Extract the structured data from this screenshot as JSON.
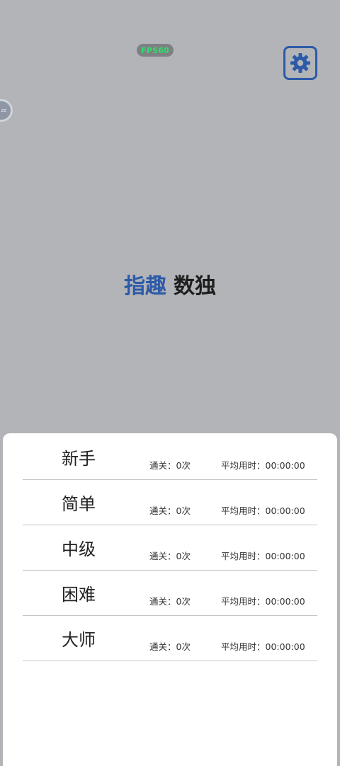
{
  "status": {
    "fps_label": "FPS60"
  },
  "toolbar": {
    "settings_icon": "gear-icon",
    "settings_color": "#2d5aa8"
  },
  "floating_badge": {
    "text": "zz"
  },
  "title": {
    "part1": "指趣",
    "part2": "数独",
    "part1_color": "#2d5aa8",
    "part2_color": "#1e1e1e"
  },
  "levels": [
    {
      "name": "新手",
      "clear_label": "通关：",
      "clear_value": "0次",
      "avg_label": "平均用时：",
      "avg_value": "00:00:00"
    },
    {
      "name": "简单",
      "clear_label": "通关：",
      "clear_value": "0次",
      "avg_label": "平均用时：",
      "avg_value": "00:00:00"
    },
    {
      "name": "中级",
      "clear_label": "通关：",
      "clear_value": "0次",
      "avg_label": "平均用时：",
      "avg_value": "00:00:00"
    },
    {
      "name": "困难",
      "clear_label": "通关：",
      "clear_value": "0次",
      "avg_label": "平均用时：",
      "avg_value": "00:00:00"
    },
    {
      "name": "大师",
      "clear_label": "通关：",
      "clear_value": "0次",
      "avg_label": "平均用时：",
      "avg_value": "00:00:00"
    }
  ]
}
